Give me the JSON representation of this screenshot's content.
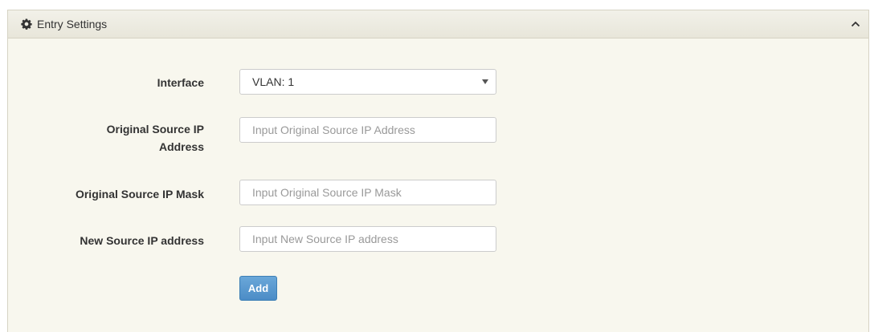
{
  "panel": {
    "title": "Entry Settings",
    "icon": "gear-icon",
    "collapse_icon": "chevron-up-icon"
  },
  "form": {
    "interface": {
      "label": "Interface",
      "value": "VLAN: 1"
    },
    "original_source_ip": {
      "label_line1": "Original Source IP",
      "label_line2": "Address",
      "placeholder": "Input Original Source IP Address",
      "value": ""
    },
    "original_source_mask": {
      "label": "Original Source IP Mask",
      "placeholder": "Input Original Source IP Mask",
      "value": ""
    },
    "new_source_ip": {
      "label": "New Source IP address",
      "placeholder": "Input New Source IP address",
      "value": ""
    },
    "add_label": "Add"
  },
  "colors": {
    "panel_background": "#f8f7ee",
    "header_background": "#ecebe1",
    "button_blue": "#5b9bd1"
  }
}
